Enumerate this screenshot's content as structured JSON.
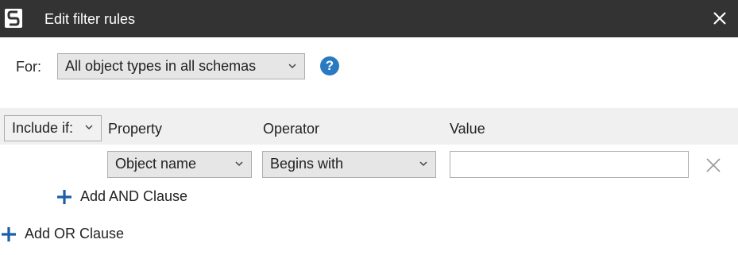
{
  "window": {
    "title": "Edit filter rules",
    "logo_icon": "redgate-s-logo",
    "close_icon": "close-icon",
    "titlebar_color": "#333333"
  },
  "scope": {
    "label": "For:",
    "selected": "All object types in all schemas",
    "help_icon_text": "?"
  },
  "rule_group": {
    "include_mode": "Include if:",
    "columns": {
      "property": "Property",
      "operator": "Operator",
      "value": "Value"
    }
  },
  "rule": {
    "property": "Object name",
    "operator": "Begins with",
    "value": "",
    "remove_icon": "remove-x-icon"
  },
  "actions": {
    "add_and": "Add AND Clause",
    "add_or": "Add OR Clause",
    "plus_color": "#1a5fa8"
  },
  "colors": {
    "help_blue": "#2a7ac2",
    "header_band": "#f0f0f0"
  }
}
